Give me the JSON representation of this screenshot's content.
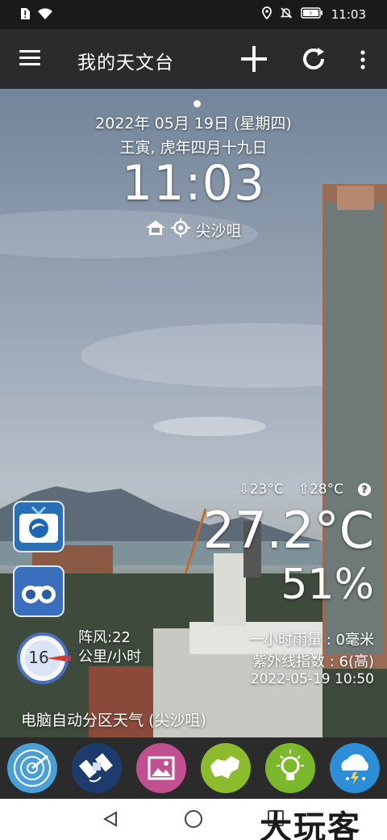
{
  "status_bar": {
    "time": "11:03"
  },
  "app_bar": {
    "title": "我的天文台"
  },
  "main": {
    "date": "2022年 05月 19日 (星期四)",
    "lunar": "王寅, 虎年四月十九日",
    "time": "11:03",
    "location": "尖沙咀",
    "min_temp": "⇩23°C",
    "max_temp": "⇧28°C",
    "help": "?",
    "temperature": "27.2°C",
    "humidity": "51%",
    "wind_speed": "16",
    "gust_label": "阵风:22",
    "gust_unit": "公里/小时",
    "rain": "一小时雨量 : 0毫米",
    "uv": "紫外线指数 : 6(高)",
    "updated": "2022-05-19 10:50",
    "region_forecast": "电脑自动分区天气 (尖沙咀)"
  },
  "colors": {
    "app_bar": "#2b2b2b",
    "status_bar": "#1a1a1a",
    "wind_arrow": "#d93a2f"
  },
  "dock": {
    "apps": [
      {
        "icon": "radar-icon",
        "color": "#4a9fd6"
      },
      {
        "icon": "satellite-icon",
        "color": "#1e3b6e"
      },
      {
        "icon": "gallery-icon",
        "color": "#c0508f"
      },
      {
        "icon": "hk-map-icon",
        "color": "#8dbb2e"
      },
      {
        "icon": "weather-tips-icon",
        "color": "#7cb82c"
      },
      {
        "icon": "thunderstorm-icon",
        "color": "#2b8ed6"
      }
    ]
  },
  "watermark": "大玩客"
}
